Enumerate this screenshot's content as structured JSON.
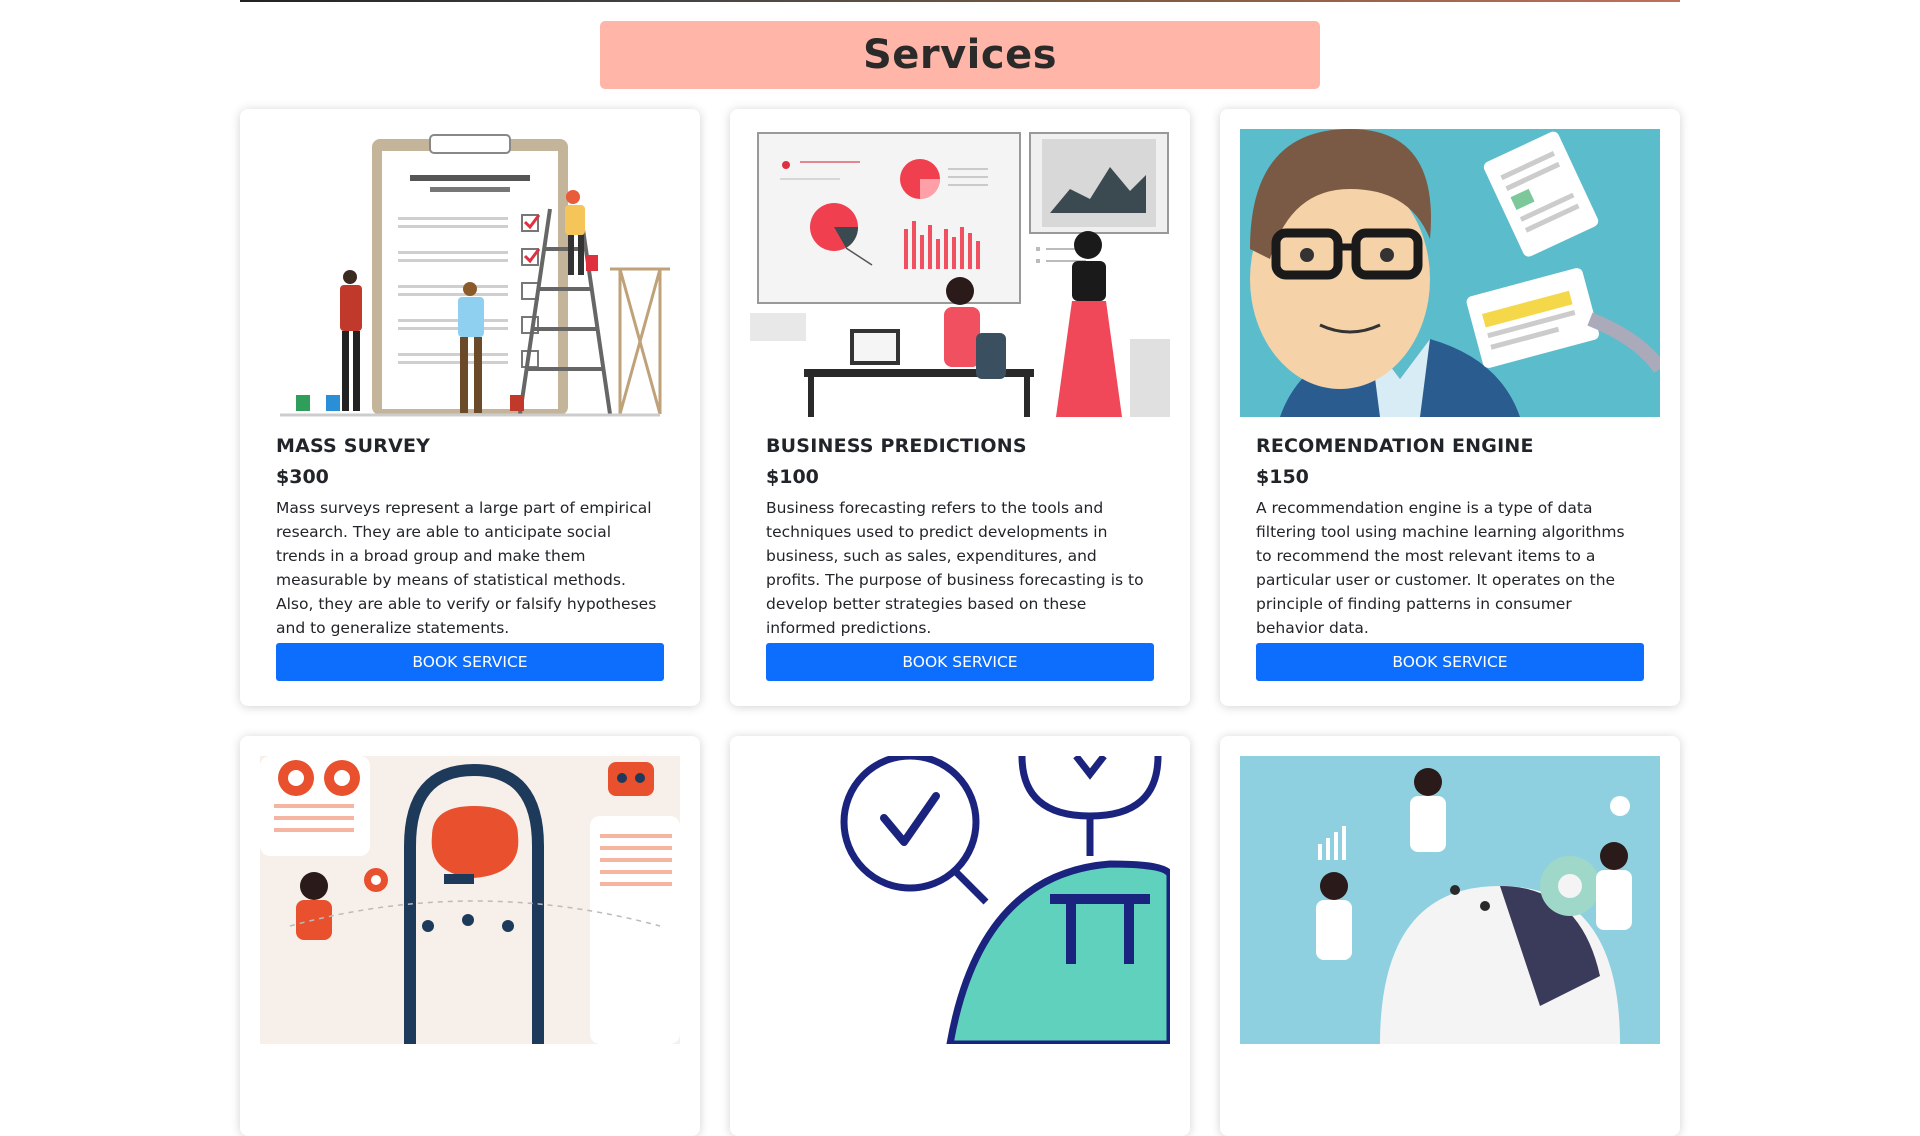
{
  "section": {
    "title": "Services"
  },
  "services": [
    {
      "title": "MASS SURVEY",
      "price": "$300",
      "description": "Mass surveys represent a large part of empirical research. They are able to anticipate social trends in a broad group and make them measurable by means of statistical methods. Also, they are able to verify or falsify hypotheses and to generalize statements.",
      "button_label": "BOOK SERVICE",
      "image": "survey-clipboard-illustration"
    },
    {
      "title": "BUSINESS PREDICTIONS",
      "price": "$100",
      "description": "Business forecasting refers to the tools and techniques used to predict developments in business, such as sales, expenditures, and profits. The purpose of business forecasting is to develop better strategies based on these informed predictions.",
      "button_label": "BOOK SERVICE",
      "image": "business-charts-illustration"
    },
    {
      "title": "RECOMENDATION ENGINE",
      "price": "$150",
      "description": "A recommendation engine is a type of data filtering tool using machine learning algorithms to recommend the most relevant items to a particular user or customer. It operates on the principle of finding patterns in consumer behavior data.",
      "button_label": "BOOK SERVICE",
      "image": "recommendation-person-illustration"
    },
    {
      "image": "ai-brain-illustration"
    },
    {
      "image": "decision-tree-illustration"
    },
    {
      "image": "ml-team-illustration"
    }
  ],
  "colors": {
    "banner": "#ffb5a7",
    "button": "#0d6efd",
    "accent_red": "#f05060",
    "accent_teal": "#5bbccc"
  }
}
